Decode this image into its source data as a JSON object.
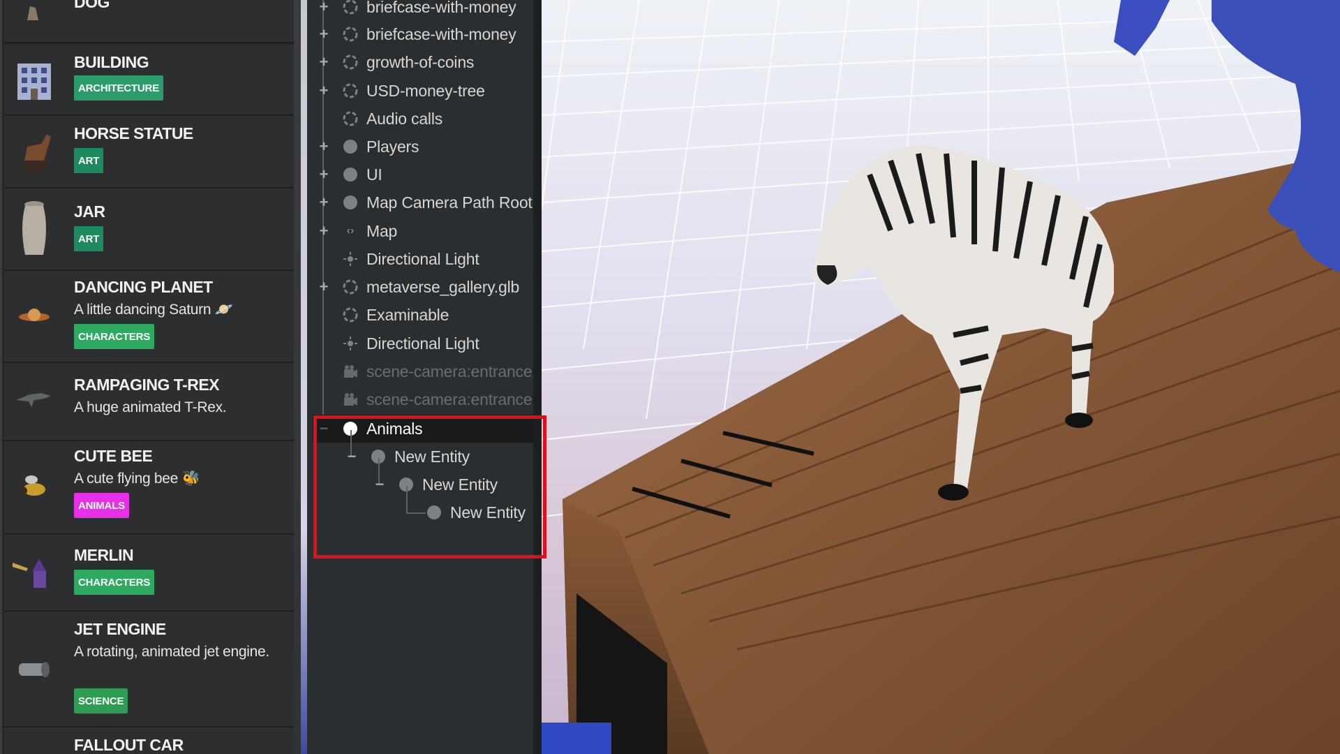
{
  "assets": [
    {
      "name": "DOG",
      "description": "",
      "tag": "",
      "tag_color": "",
      "icon": "dog-icon"
    },
    {
      "name": "BUILDING",
      "description": "",
      "tag": "ARCHITECTURE",
      "tag_color": "#2c9c6a",
      "icon": "building-icon"
    },
    {
      "name": "HORSE STATUE",
      "description": "",
      "tag": "ART",
      "tag_color": "#1f8a5f",
      "icon": "horse-statue-icon"
    },
    {
      "name": "JAR",
      "description": "",
      "tag": "ART",
      "tag_color": "#1f8a5f",
      "icon": "jar-icon"
    },
    {
      "name": "DANCING PLANET",
      "description": "A little dancing Saturn",
      "tag": "CHARACTERS",
      "tag_color": "#2eaa60",
      "icon": "saturn-icon"
    },
    {
      "name": "RAMPAGING T-REX",
      "description": "A huge animated T-Rex.",
      "tag": "",
      "tag_color": "",
      "icon": "t-rex-icon"
    },
    {
      "name": "CUTE BEE",
      "description": "A cute flying bee",
      "tag": "ANIMALS",
      "tag_color": "#e62fe6",
      "icon": "bee-icon"
    },
    {
      "name": "MERLIN",
      "description": "",
      "tag": "CHARACTERS",
      "tag_color": "#2eaa60",
      "icon": "wizard-icon"
    },
    {
      "name": "JET ENGINE",
      "description": "A rotating, animated jet engine.",
      "tag": "SCIENCE",
      "tag_color": "#2e9c52",
      "icon": "jet-engine-icon"
    },
    {
      "name": "FALLOUT CAR",
      "description": "",
      "tag": "",
      "tag_color": "",
      "icon": "car-icon"
    }
  ],
  "hierarchy": {
    "nodes": [
      {
        "label": "briefcase-with-money",
        "icon": "model-icon",
        "toggle": "+"
      },
      {
        "label": "briefcase-with-money",
        "icon": "model-icon",
        "toggle": "+"
      },
      {
        "label": "growth-of-coins",
        "icon": "model-icon",
        "toggle": "+"
      },
      {
        "label": "USD-money-tree",
        "icon": "model-icon",
        "toggle": "+"
      },
      {
        "label": "Audio calls",
        "icon": "model-icon",
        "toggle": ""
      },
      {
        "label": "Players",
        "icon": "entity-dot-icon",
        "toggle": "+"
      },
      {
        "label": "UI",
        "icon": "entity-dot-icon",
        "toggle": "+"
      },
      {
        "label": "Map Camera Path Root",
        "icon": "entity-dot-icon",
        "toggle": "+"
      },
      {
        "label": "Map",
        "icon": "code-icon",
        "toggle": "+"
      },
      {
        "label": "Directional Light",
        "icon": "light-icon",
        "toggle": ""
      },
      {
        "label": "metaverse_gallery.glb",
        "icon": "model-icon",
        "toggle": "+"
      },
      {
        "label": "Examinable",
        "icon": "model-icon",
        "toggle": ""
      },
      {
        "label": "Directional Light",
        "icon": "light-icon",
        "toggle": ""
      },
      {
        "label": "scene-camera:entrance",
        "icon": "camera-icon",
        "toggle": ""
      },
      {
        "label": "scene-camera:entrance",
        "icon": "camera-icon",
        "toggle": ""
      },
      {
        "label": "Animals",
        "icon": "entity-dot-icon",
        "toggle": "−"
      },
      {
        "label": "New Entity",
        "icon": "entity-dot-icon",
        "toggle": "−"
      },
      {
        "label": "New Entity",
        "icon": "entity-dot-icon",
        "toggle": "−"
      },
      {
        "label": "New Entity",
        "icon": "entity-dot-icon",
        "toggle": ""
      }
    ]
  },
  "colors": {
    "highlight": "#e0101a",
    "panel": "#2b2e30",
    "selected": "#17191a"
  }
}
